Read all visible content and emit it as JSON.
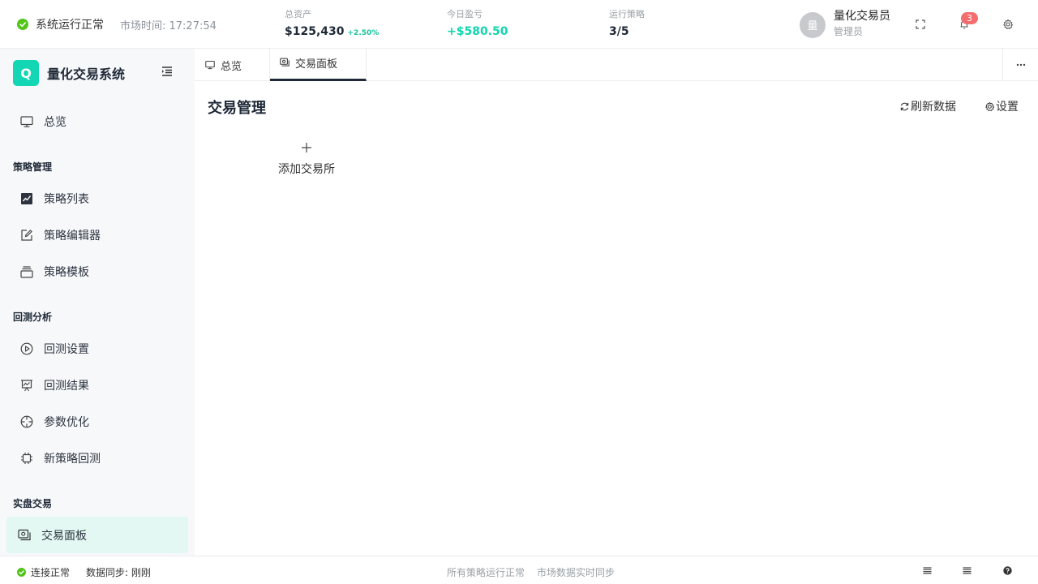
{
  "header": {
    "system_status": "系统运行正常",
    "market_time": "市场时间: 17:27:54",
    "total_assets": {
      "label": "总资产",
      "value": "$125,430",
      "change": "+2.50%"
    },
    "today_pnl": {
      "label": "今日盈亏",
      "value": "+$580.50"
    },
    "running_strategies": {
      "label": "运行策略",
      "value": "3/5"
    },
    "user": {
      "avatar_text": "量",
      "name": "量化交易员",
      "role": "管理员"
    },
    "notification_count": "3",
    "colors": {
      "accent": "#12d6b4",
      "positive": "#11d6b0",
      "badge": "#f56c6c",
      "status_ok": "#52c41a"
    }
  },
  "sidebar": {
    "logo_letter": "Q",
    "app_name": "量化交易系统",
    "overview": {
      "label": "总览",
      "icon": "monitor-icon"
    },
    "groups": [
      {
        "title": "策略管理",
        "items": [
          {
            "label": "策略列表",
            "icon": "line-chart-icon"
          },
          {
            "label": "策略编辑器",
            "icon": "edit-icon"
          },
          {
            "label": "策略模板",
            "icon": "template-stack-icon"
          }
        ]
      },
      {
        "title": "回测分析",
        "items": [
          {
            "label": "回测设置",
            "icon": "play-circle-icon"
          },
          {
            "label": "回测结果",
            "icon": "chart-board-icon"
          },
          {
            "label": "参数优化",
            "icon": "crosshair-icon"
          },
          {
            "label": "新策略回测",
            "icon": "chip-icon"
          }
        ]
      },
      {
        "title": "实盘交易",
        "items": [
          {
            "label": "交易面板",
            "icon": "trading-panel-icon",
            "active": true
          }
        ]
      }
    ]
  },
  "tabs": [
    {
      "label": "总览",
      "icon": "monitor-icon"
    },
    {
      "label": "交易面板",
      "icon": "trading-panel-icon",
      "active": true
    }
  ],
  "main": {
    "title": "交易管理",
    "refresh_label": "刷新数据",
    "settings_label": "设置",
    "add_exchange_label": "添加交易所"
  },
  "footer": {
    "connection": "连接正常",
    "sync": "数据同步: 刚刚",
    "strategies_status": "所有策略运行正常",
    "market_sync": "市场数据实时同步"
  }
}
